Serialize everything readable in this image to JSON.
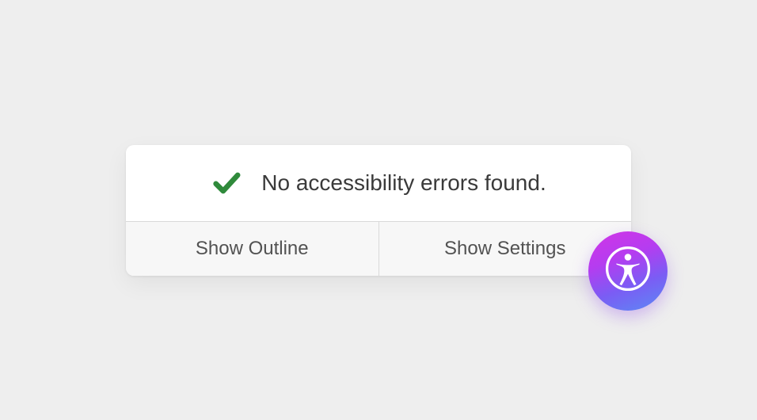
{
  "status": {
    "message": "No accessibility errors found.",
    "icon": "checkmark-icon",
    "icon_color": "#2f8a3b"
  },
  "buttons": {
    "outline_label": "Show Outline",
    "settings_label": "Show Settings"
  },
  "badge": {
    "icon": "accessibility-icon"
  }
}
